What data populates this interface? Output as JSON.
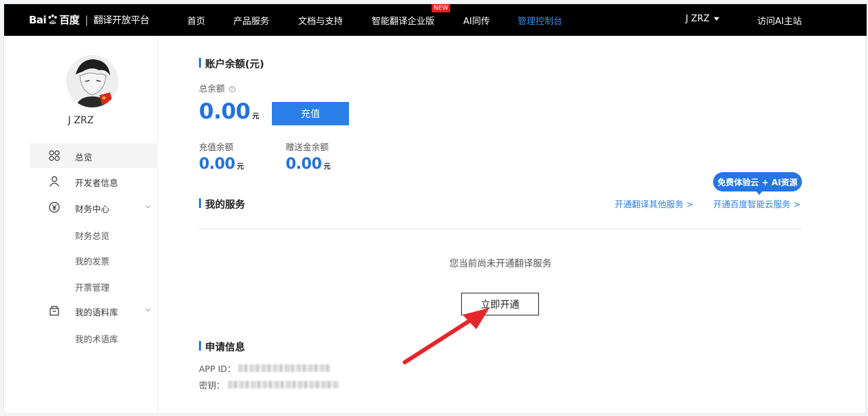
{
  "header": {
    "logo_brand": "Bai",
    "logo_brand_cn": "百度",
    "logo_separator": "|",
    "logo_platform": "翻译开放平台",
    "nav": [
      {
        "label": "首页"
      },
      {
        "label": "产品服务"
      },
      {
        "label": "文档与支持"
      },
      {
        "label": "智能翻译企业版"
      },
      {
        "label": "AI同传"
      },
      {
        "label": "管理控制台"
      }
    ],
    "new_badge": "NEW",
    "user_name": "J ZRZ",
    "visit_site": "访问AI主站",
    "accent_color": "#3a8ee6"
  },
  "sidebar": {
    "username": "J ZRZ",
    "items": [
      {
        "label": "总览",
        "icon": "grid-icon"
      },
      {
        "label": "开发者信息",
        "icon": "user-icon"
      },
      {
        "label": "财务中心",
        "icon": "yen-icon"
      },
      {
        "label": "财务总览"
      },
      {
        "label": "我的发票"
      },
      {
        "label": "开票管理"
      },
      {
        "label": "我的语料库",
        "icon": "box-icon"
      },
      {
        "label": "我的术语库"
      }
    ]
  },
  "balance": {
    "title": "账户余额(元)",
    "total_label": "总余额",
    "total_value": "0.00",
    "unit": "元",
    "recharge_button": "充值",
    "recharge_label": "充值余额",
    "recharge_value": "0.00",
    "gift_label": "赠送金余额",
    "gift_value": "0.00"
  },
  "services": {
    "title": "我的服务",
    "link_other": "开通翻译其他服务 >",
    "link_cloud": "开通百度智能云服务 >",
    "promo": "免费体验云 + AI资源",
    "empty_message": "您当前尚未开通翻译服务",
    "open_button": "立即开通"
  },
  "application": {
    "title": "申请信息",
    "app_id_label": "APP ID：",
    "secret_label": "密钥："
  },
  "colors": {
    "primary": "#2a7fe8",
    "amount": "#2372de",
    "annotation_arrow": "#e5262b"
  }
}
